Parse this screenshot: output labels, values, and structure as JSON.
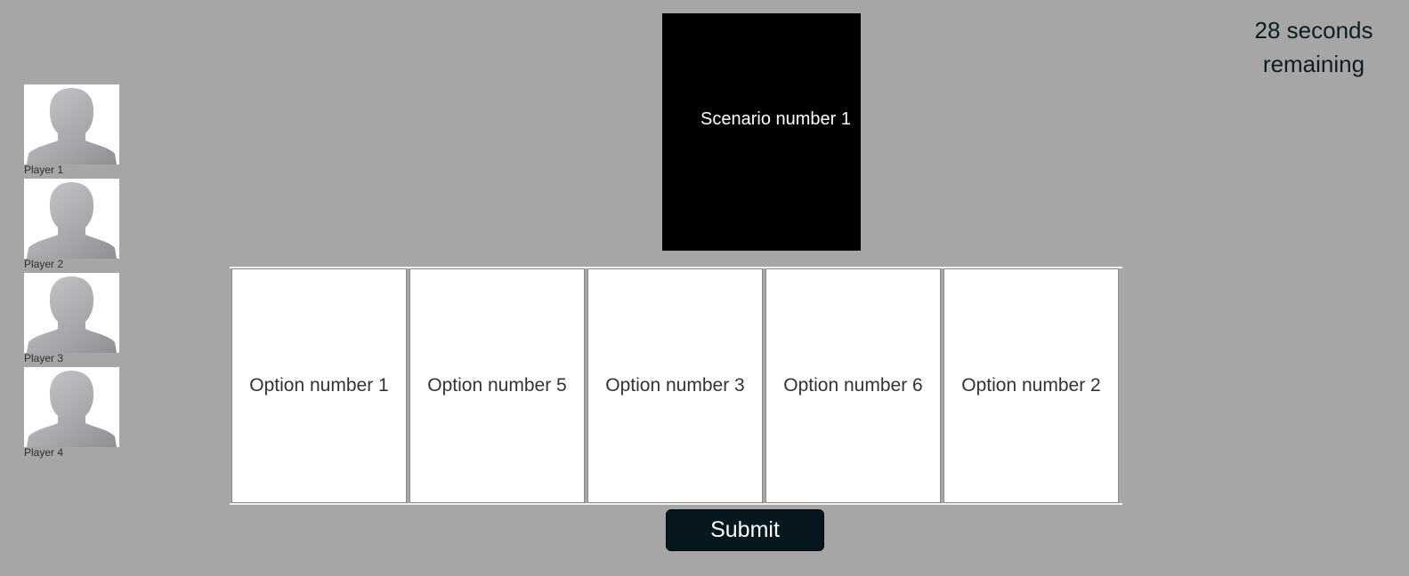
{
  "timer": {
    "line1": "28 seconds",
    "line2": "remaining"
  },
  "scenario": {
    "label": "Scenario number 1"
  },
  "players": [
    {
      "name": "Player 1",
      "icon": "avatar-silhouette-icon"
    },
    {
      "name": "Player 2",
      "icon": "avatar-silhouette-icon"
    },
    {
      "name": "Player 3",
      "icon": "avatar-silhouette-icon"
    },
    {
      "name": "Player 4",
      "icon": "avatar-silhouette-icon"
    }
  ],
  "options": [
    {
      "label": "Option number 1"
    },
    {
      "label": "Option number 5"
    },
    {
      "label": "Option number 3"
    },
    {
      "label": "Option number 6"
    },
    {
      "label": "Option number 2"
    }
  ],
  "submit": {
    "label": "Submit"
  },
  "colors": {
    "background": "#a6a6a6",
    "scenario_card": "#000000",
    "submit_button": "#07171f",
    "option_card": "#ffffff"
  }
}
